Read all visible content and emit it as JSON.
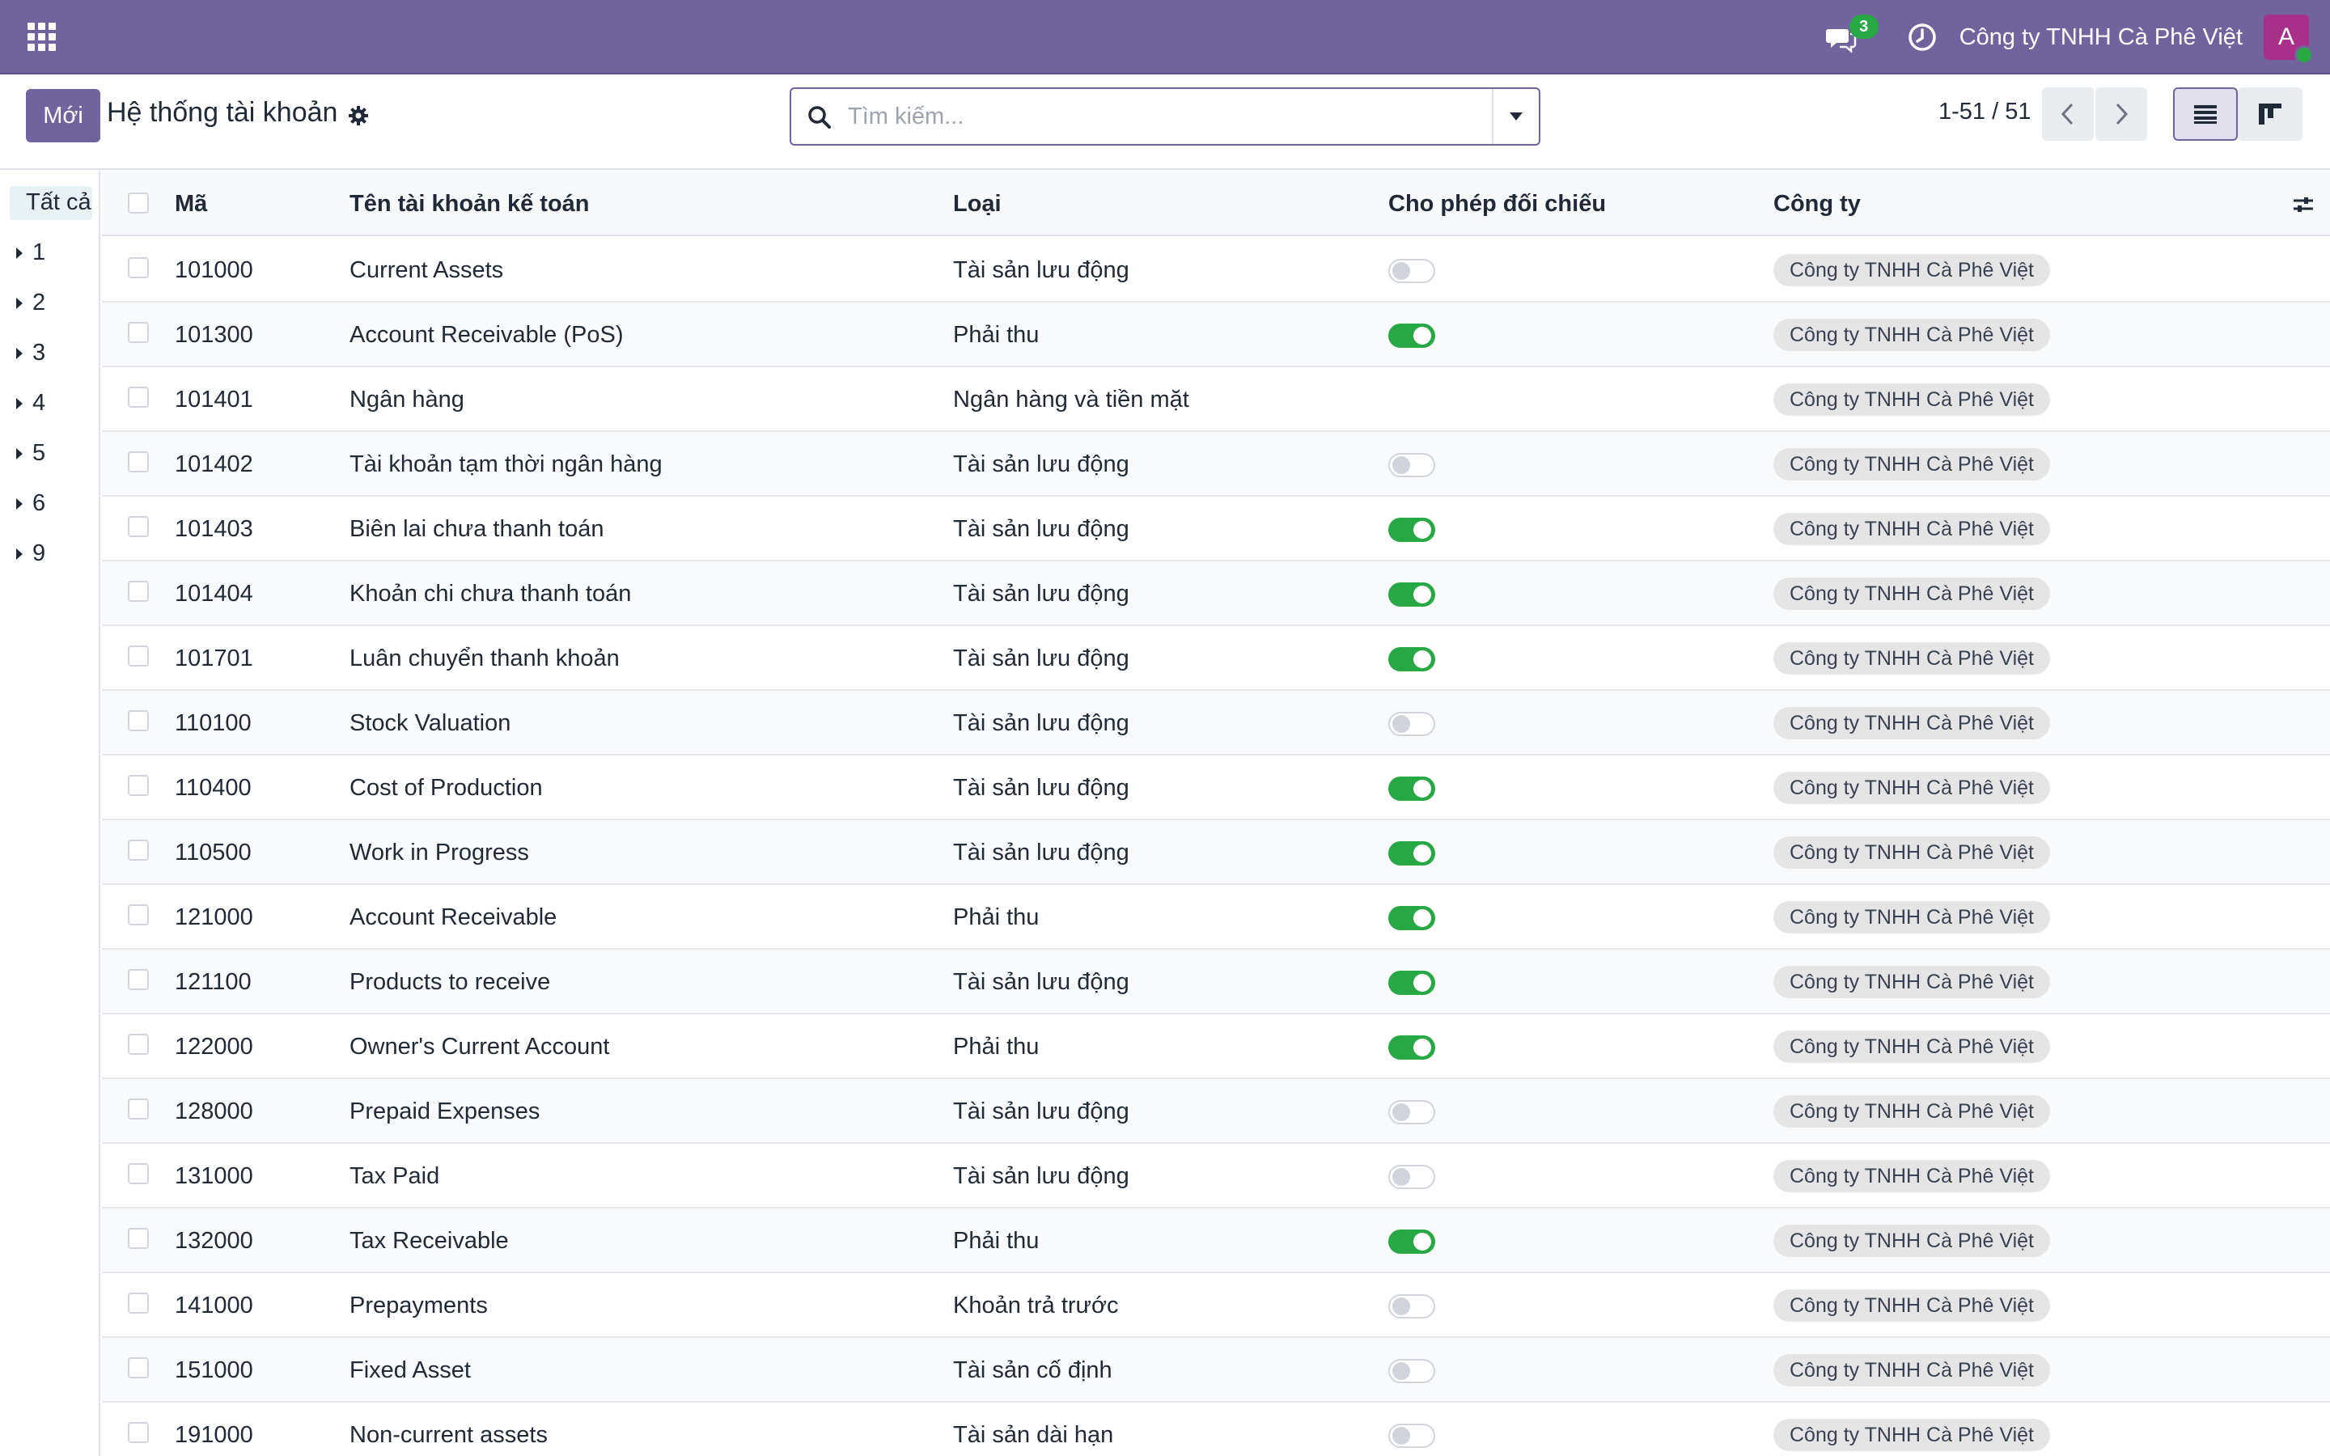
{
  "navbar": {
    "apps_icon": "apps-grid-icon",
    "messages_count": "3",
    "company": "Công ty TNHH Cà Phê Việt",
    "avatar_letter": "A",
    "bg_color": "#71639e"
  },
  "control": {
    "new_label": "Mới",
    "title": "Hệ thống tài khoản",
    "search_placeholder": "Tìm kiếm...",
    "pager": "1-51 / 51"
  },
  "groups": {
    "all_label": "Tất cả",
    "items": [
      "1",
      "2",
      "3",
      "4",
      "5",
      "6",
      "9"
    ]
  },
  "table": {
    "headers": {
      "code": "Mã",
      "name": "Tên tài khoản kế toán",
      "type": "Loại",
      "reconcile": "Cho phép đối chiếu",
      "company": "Công ty"
    },
    "rows": [
      {
        "code": "101000",
        "name": "Current Assets",
        "type": "Tài sản lưu động",
        "reconcile": "off",
        "company": "Công ty TNHH Cà Phê Việt"
      },
      {
        "code": "101300",
        "name": "Account Receivable (PoS)",
        "type": "Phải thu",
        "reconcile": "on",
        "company": "Công ty TNHH Cà Phê Việt"
      },
      {
        "code": "101401",
        "name": "Ngân hàng",
        "type": "Ngân hàng và tiền mặt",
        "reconcile": "none",
        "company": "Công ty TNHH Cà Phê Việt"
      },
      {
        "code": "101402",
        "name": "Tài khoản tạm thời ngân hàng",
        "type": "Tài sản lưu động",
        "reconcile": "off",
        "company": "Công ty TNHH Cà Phê Việt"
      },
      {
        "code": "101403",
        "name": "Biên lai chưa thanh toán",
        "type": "Tài sản lưu động",
        "reconcile": "on",
        "company": "Công ty TNHH Cà Phê Việt"
      },
      {
        "code": "101404",
        "name": "Khoản chi chưa thanh toán",
        "type": "Tài sản lưu động",
        "reconcile": "on",
        "company": "Công ty TNHH Cà Phê Việt"
      },
      {
        "code": "101701",
        "name": "Luân chuyển thanh khoản",
        "type": "Tài sản lưu động",
        "reconcile": "on",
        "company": "Công ty TNHH Cà Phê Việt"
      },
      {
        "code": "110100",
        "name": "Stock Valuation",
        "type": "Tài sản lưu động",
        "reconcile": "off",
        "company": "Công ty TNHH Cà Phê Việt"
      },
      {
        "code": "110400",
        "name": "Cost of Production",
        "type": "Tài sản lưu động",
        "reconcile": "on",
        "company": "Công ty TNHH Cà Phê Việt"
      },
      {
        "code": "110500",
        "name": "Work in Progress",
        "type": "Tài sản lưu động",
        "reconcile": "on",
        "company": "Công ty TNHH Cà Phê Việt"
      },
      {
        "code": "121000",
        "name": "Account Receivable",
        "type": "Phải thu",
        "reconcile": "on",
        "company": "Công ty TNHH Cà Phê Việt"
      },
      {
        "code": "121100",
        "name": "Products to receive",
        "type": "Tài sản lưu động",
        "reconcile": "on",
        "company": "Công ty TNHH Cà Phê Việt"
      },
      {
        "code": "122000",
        "name": "Owner's Current Account",
        "type": "Phải thu",
        "reconcile": "on",
        "company": "Công ty TNHH Cà Phê Việt"
      },
      {
        "code": "128000",
        "name": "Prepaid Expenses",
        "type": "Tài sản lưu động",
        "reconcile": "off",
        "company": "Công ty TNHH Cà Phê Việt"
      },
      {
        "code": "131000",
        "name": "Tax Paid",
        "type": "Tài sản lưu động",
        "reconcile": "off",
        "company": "Công ty TNHH Cà Phê Việt"
      },
      {
        "code": "132000",
        "name": "Tax Receivable",
        "type": "Phải thu",
        "reconcile": "on",
        "company": "Công ty TNHH Cà Phê Việt"
      },
      {
        "code": "141000",
        "name": "Prepayments",
        "type": "Khoản trả trước",
        "reconcile": "off",
        "company": "Công ty TNHH Cà Phê Việt"
      },
      {
        "code": "151000",
        "name": "Fixed Asset",
        "type": "Tài sản cố định",
        "reconcile": "off",
        "company": "Công ty TNHH Cà Phê Việt"
      },
      {
        "code": "191000",
        "name": "Non-current assets",
        "type": "Tài sản dài hạn",
        "reconcile": "off",
        "company": "Công ty TNHH Cà Phê Việt"
      }
    ]
  }
}
